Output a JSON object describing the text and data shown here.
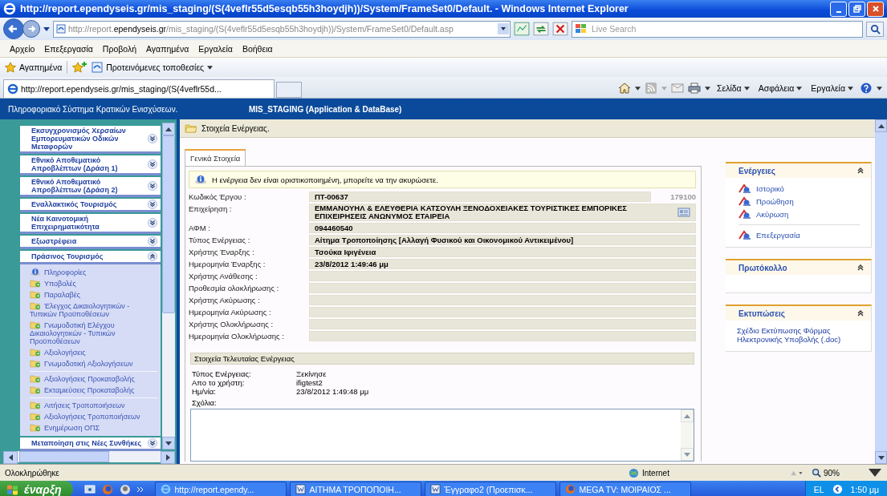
{
  "window": {
    "title": "http://report.ependyseis.gr/mis_staging/(S(4veflr55d5esqb55h3hoydjh))/System/FrameSet0/Default. - Windows Internet Explorer"
  },
  "address_bar": {
    "url_prefix": "http://report.",
    "url_domain": "ependyseis.gr",
    "url_path": "/mis_staging/(S(4veflr55d5esqb55h3hoydjh))/System/FrameSet0/Default.asp",
    "search_placeholder": "Live Search"
  },
  "menu": [
    "Αρχείο",
    "Επεξεργασία",
    "Προβολή",
    "Αγαπημένα",
    "Εργαλεία",
    "Βοήθεια"
  ],
  "favorites_bar": {
    "favorites": "Αγαπημένα",
    "suggested": "Προτεινόμενες τοποθεσίες"
  },
  "tabs": [
    {
      "title": "http://report.ependyseis.gr/mis_staging/(S(4veflr55d...",
      "selected": true
    }
  ],
  "command_bar": [
    "Σελίδα",
    "Ασφάλεια",
    "Εργαλεία"
  ],
  "app_header": {
    "system": "Πληροφοριακό Σύστημα Κρατικών Ενισχύσεων.",
    "database": "MIS_STAGING (Application & DataBase)"
  },
  "sidebar": {
    "sections": [
      {
        "title": "Εκσυγχρονισμός Χερσαίων Εμπορευματικών Οδικών Μεταφορών",
        "expanded": false
      },
      {
        "title": "Εθνικό Αποθεματικό Απροβλέπτων (Δράση 1)",
        "expanded": false
      },
      {
        "title": "Εθνικό Αποθεματικό Απροβλέπτων (Δράση 2)",
        "expanded": false
      },
      {
        "title": "Εναλλακτικός Τουρισμός",
        "expanded": false
      },
      {
        "title": "Νέα Καινοτομική Επιχειρηματικότητα",
        "expanded": false
      },
      {
        "title": "Εξωστρέφεια",
        "expanded": false
      },
      {
        "title": "Πράσινος Τουρισμός",
        "expanded": true,
        "groups": [
          {
            "items": [
              {
                "label": "Πληροφορίες",
                "kind": "info"
              },
              {
                "label": "Υποβολές",
                "kind": "folder"
              },
              {
                "label": "Παραλαβές",
                "kind": "folder"
              },
              {
                "label": "Έλεγχος Δικαιολογητικών - Τυπικών Προϋποθέσεων",
                "kind": "folder"
              },
              {
                "label": "Γνωμοδοτική Ελέγχου Δικαιολογητικών - Τυπικών Προϋποθέσεων",
                "kind": "folder"
              },
              {
                "label": "Αξιολογήσεις",
                "kind": "folder"
              },
              {
                "label": "Γνωμοδοτική Αξιολογήσεων",
                "kind": "folder"
              }
            ]
          },
          {
            "items": [
              {
                "label": "Αξιολογήσεις Προκαταβολής",
                "kind": "folder"
              },
              {
                "label": "Εκταμιεύσεις Προκαταβολής",
                "kind": "folder"
              }
            ]
          },
          {
            "items": [
              {
                "label": "Αιτήσεις Τροποποιήσεων",
                "kind": "folder"
              },
              {
                "label": "Αξιολογήσεις Τροποποιήσεων",
                "kind": "folder"
              },
              {
                "label": "Ενημέρωση ΟΠΣ",
                "kind": "folder"
              }
            ]
          }
        ]
      },
      {
        "title": "Μεταποίηση στις Νέες Συνθήκες",
        "expanded": false
      }
    ]
  },
  "page": {
    "title": "Στοιχεία Ενέργειας.",
    "tabs": [
      {
        "label": "Γενικά Στοιχεία",
        "selected": true
      }
    ],
    "notice": "Η ενέργεια δεν είναι οριστικοποιημένη, μπορείτε να την ακυρώσετε.",
    "fields": [
      {
        "label": "Κωδικός Έργου :",
        "value": "ΠΤ-00637",
        "extra": "179100",
        "kind": "text"
      },
      {
        "label": "Επιχείρηση :",
        "value": "ΕΜΜΑΝΟΥΗΛ & ΕΛΕΥΘΕΡΙΑ ΚΑΤΣΟΥΛΗ ΞΕΝΟΔΟΧΕΙΑΚΕΣ ΤΟΥΡΙΣΤΙΚΕΣ ΕΜΠΟΡΙΚΕΣ ΕΠΙΧΕΙΡΗΣΕΙΣ ΑΝΩΝΥΜΟΣ ΕΤΑΙΡΕΙΑ",
        "kind": "lookup"
      },
      {
        "label": "ΑΦΜ :",
        "value": "094460540",
        "kind": "text"
      },
      {
        "label": "Τύπος Ενέργειας :",
        "value": "Αίτημα Τροποποίησης [Αλλαγή Φυσικού και Οικονομικού Αντικειμένου]",
        "kind": "text"
      },
      {
        "label": "Χρήστης Έναρξης :",
        "value": "Τσούκα Ιφιγένεια",
        "kind": "text"
      },
      {
        "label": "Ημερομηνία Έναρξης :",
        "value": "23/8/2012 1:49:46 μμ",
        "kind": "text"
      },
      {
        "label": "Χρήστης Ανάθεσης :",
        "kind": "text"
      },
      {
        "label": "Προθεσμία ολοκλήρωσης :",
        "kind": "text"
      },
      {
        "label": "Χρήστης Ακύρωσης :",
        "kind": "text"
      },
      {
        "label": "Ημερομηνία Ακύρωσης :",
        "kind": "text"
      },
      {
        "label": "Χρήστης Ολοκλήρωσης :",
        "kind": "text"
      },
      {
        "label": "Ημερομηνία Ολοκλήρωσης :",
        "kind": "text"
      }
    ],
    "last_action": {
      "title": "Στοιχεία Τελευταίας Ενέργειας",
      "rows": [
        {
          "label": "Τύπος Ενέργειας:",
          "value": "Ξεκίνησε"
        },
        {
          "label": "Απο το χρήστη:",
          "value": "ifigtest2"
        },
        {
          "label": "Ημ/νία:",
          "value": "23/8/2012 1:49:48 μμ"
        }
      ],
      "comments_label": "Σχόλια:"
    }
  },
  "panels": [
    {
      "title": "Ενέργειες",
      "expanded": true,
      "kind": "actions",
      "groups": [
        {
          "items": [
            "Ιστορικό",
            "Προώθηση",
            "Ακύρωση"
          ]
        },
        {
          "items": [
            "Επεξεργασία"
          ]
        }
      ]
    },
    {
      "title": "Πρωτόκολλο",
      "expanded": true,
      "kind": "actions"
    },
    {
      "title": "Εκτυπώσεις",
      "expanded": true,
      "kind": "links",
      "groups": [
        {
          "items": [
            "Σχέδιο Εκτύπωσης Φόρμας Ηλεκτρονικής Υποβολής (.doc)"
          ]
        }
      ]
    }
  ],
  "status_bar": {
    "text": "Ολοκληρώθηκε",
    "zone": "Internet",
    "zoom": "90%"
  },
  "taskbar": {
    "start": "έναρξη",
    "tasks": [
      {
        "label": "http://report.ependy...",
        "kind": "ie"
      },
      {
        "label": "ΑΙΤΗΜΑ ΤΡΟΠΟΠΟΙΗ...",
        "kind": "word"
      },
      {
        "label": "Έγγραφο2 (Προεπισκ...",
        "kind": "word"
      },
      {
        "label": "MEGA TV: ΜΟΙΡΑΙΟΣ ...",
        "kind": "firefox"
      }
    ],
    "language": "EL",
    "clock": "1:50 μμ"
  }
}
